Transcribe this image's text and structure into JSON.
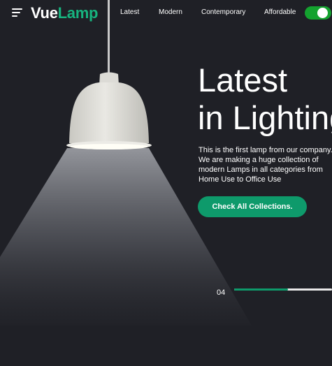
{
  "app": {
    "logo_part1": "Vue",
    "logo_part2": "Lamp"
  },
  "header": {
    "nav_items": [
      "Latest",
      "Modern",
      "Contemporary",
      "Affordable"
    ],
    "theme_toggle_on": true
  },
  "hero": {
    "title_line1": "Latest",
    "title_line2": "in Lighting",
    "description": "This is the first lamp from our company. We are making a huge collection of modern Lamps in all categories from Home Use to Office Use",
    "cta_label": "Check All Collections."
  },
  "slider": {
    "current_slide": "04",
    "progress_fraction": 0.55
  },
  "colors": {
    "background": "#1f2026",
    "accent": "#0e9a6b",
    "logo_accent": "#17b47f",
    "toggle_on": "#14a22f"
  }
}
